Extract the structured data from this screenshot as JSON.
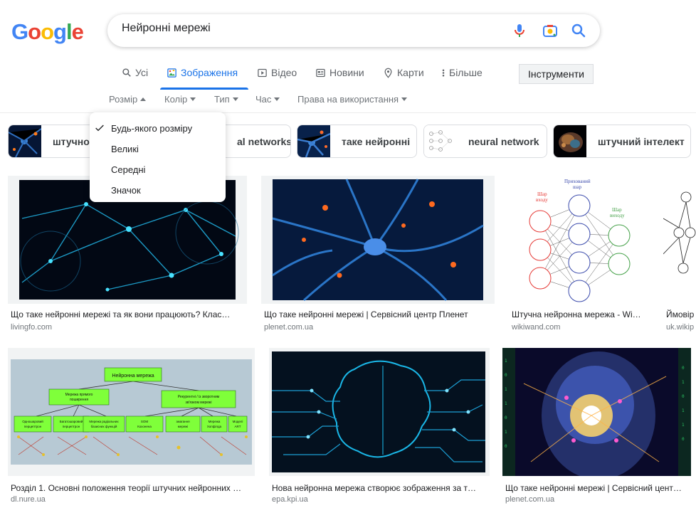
{
  "search": {
    "query": "Нейронні мережі"
  },
  "tabs": [
    {
      "label": "Усі",
      "icon": "search-icon"
    },
    {
      "label": "Зображення",
      "icon": "image-icon",
      "active": true
    },
    {
      "label": "Відео",
      "icon": "video-icon"
    },
    {
      "label": "Новини",
      "icon": "news-icon"
    },
    {
      "label": "Карти",
      "icon": "map-pin-icon"
    },
    {
      "label": "Більше",
      "icon": "more-vert-icon"
    }
  ],
  "tools_label": "Інструменти",
  "filters": [
    {
      "label": "Розмір",
      "open": true
    },
    {
      "label": "Колір"
    },
    {
      "label": "Тип"
    },
    {
      "label": "Час"
    },
    {
      "label": "Права на використання"
    }
  ],
  "size_menu": [
    {
      "label": "Будь-якого розміру",
      "checked": true
    },
    {
      "label": "Великі"
    },
    {
      "label": "Середні"
    },
    {
      "label": "Значок"
    }
  ],
  "chips": [
    {
      "label": "штучног"
    },
    {
      "label": "al networks"
    },
    {
      "label": "таке нейронні"
    },
    {
      "label": "neural network"
    },
    {
      "label": "штучний інтелект"
    }
  ],
  "results": [
    {
      "title": "Що таке нейронні мережі та як вони працюють? Клас…",
      "source": "livingfo.com"
    },
    {
      "title": "Що таке нейронні мережі | Сервісний центр Пленет",
      "source": "plenet.com.ua"
    },
    {
      "title": "Штучна нейронна мережа - Wi…",
      "source": "wikiwand.com"
    },
    {
      "title": "Ймовір",
      "source": "uk.wikip"
    },
    {
      "title": "Розділ 1. Основні положення теорії штучних нейронних …",
      "source": "dl.nure.ua"
    },
    {
      "title": "Нова нейронна мережа створює зображення за т…",
      "source": "epa.kpi.ua"
    },
    {
      "title": "Що таке нейронні мережі | Сервісний цент…",
      "source": "plenet.com.ua"
    }
  ],
  "diagram_labels": {
    "input": "Шар\nвходу",
    "hidden": "Прихований\nшар",
    "output": "Шар\nвиходу",
    "root": "Нейронна мережа",
    "ff": "Мережа прямого\nпоширення",
    "rec": "Рекурентні / із зворотним\nзв'язком мережі",
    "b1": "Одношаровий\nперцептрон",
    "b2": "Багатошаровий\nперцептрон",
    "b3": "Мережа радіальних\nбазисних функцій",
    "b4": "SOM\nКохонена",
    "b5": "змагання\nмережі",
    "b6": "Мережа\nХопфілда",
    "b7": "Моделі\nART"
  },
  "colors": {
    "accent": "#1a73e8",
    "g_blue": "#4285f4",
    "g_red": "#ea4335",
    "g_yellow": "#fbbc05",
    "g_green": "#34a853"
  }
}
